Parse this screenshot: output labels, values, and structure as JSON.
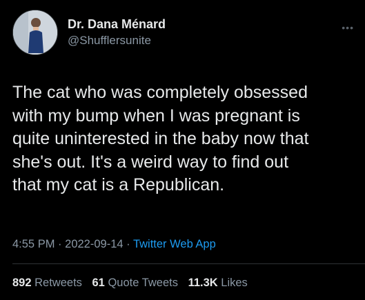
{
  "author": {
    "display_name": "Dr. Dana Ménard",
    "handle": "@Shufflersunite"
  },
  "tweet": {
    "text": "The cat who was completely obsessed\nwith my bump when I was pregnant is\nquite uninterested in the baby now that\nshe's out. It's a weird way to find out\nthat my cat is a Republican.",
    "time": "4:55 PM",
    "separator": "·",
    "date": "2022-09-14",
    "source": "Twitter Web App"
  },
  "stats": {
    "retweets_count": "892",
    "retweets_label": "Retweets",
    "quotes_count": "61",
    "quotes_label": "Quote Tweets",
    "likes_count": "11.3K",
    "likes_label": "Likes"
  },
  "icons": {
    "more": "more-options-icon",
    "avatar": "profile-photo"
  },
  "colors": {
    "background": "#000000",
    "text": "#e7e9ea",
    "secondary": "#8b98a5",
    "link": "#1d9bf0"
  }
}
